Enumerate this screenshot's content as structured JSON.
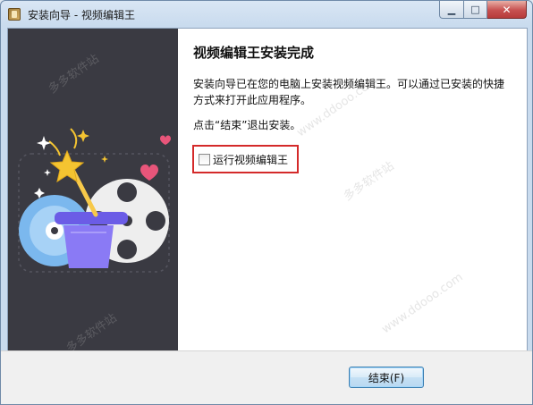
{
  "window": {
    "title": "安装向导 - 视频编辑王",
    "minimize_glyph": "▁",
    "maximize_glyph": "□",
    "close_glyph": "✕"
  },
  "content": {
    "heading": "视频编辑王安装完成",
    "description": "安装向导已在您的电脑上安装视频编辑王。可以通过已安装的快捷方式来打开此应用程序。",
    "exit_hint": "点击“结束”退出安装。",
    "run_checkbox_label": "运行视频编辑王",
    "run_checkbox_checked": false
  },
  "footer": {
    "finish_label": "结束(F)"
  },
  "watermarks": [
    "多多软件站",
    "www.ddooo.com"
  ],
  "colors": {
    "side_panel": "#3a3a42",
    "highlight_border": "#d42a2a",
    "hat": "#7c6cf0",
    "film_reel": "#eeeeee",
    "disc": "#7bb8ee",
    "heart": "#e8557a",
    "star": "#f4c431"
  }
}
